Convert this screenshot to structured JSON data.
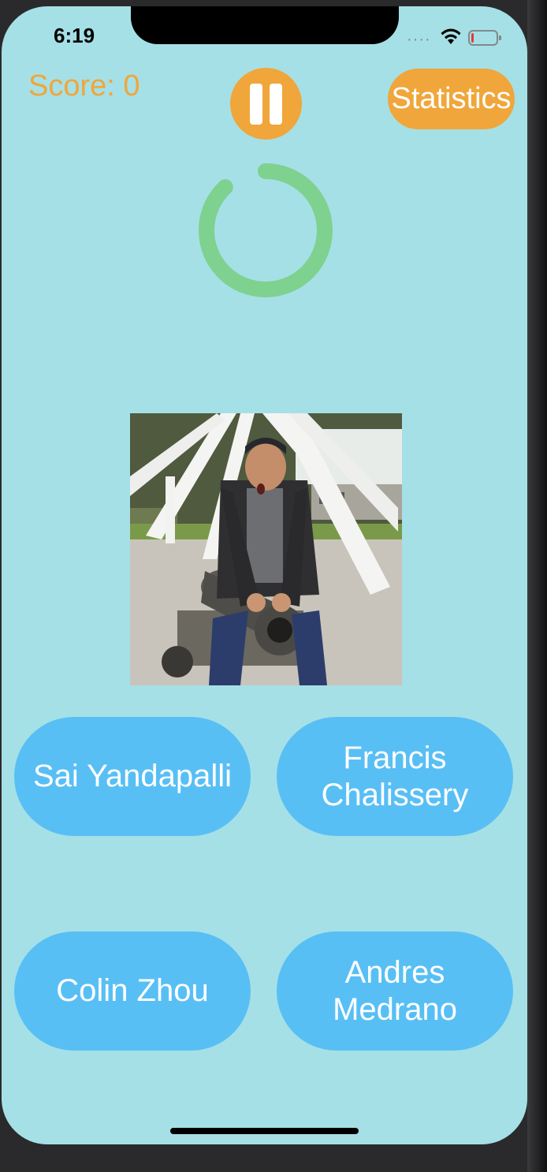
{
  "status_bar": {
    "time": "6:19",
    "signal_icon": "cellular-dots",
    "wifi_icon": "wifi",
    "battery_icon": "battery-low",
    "battery_level": 0.08
  },
  "header": {
    "score_text": "Score: 0",
    "pause_icon": "pause",
    "statistics_label": "Statistics"
  },
  "timer": {
    "progress": 0.88
  },
  "photo": {
    "subject": "person sitting on cannon"
  },
  "answers": [
    {
      "label": "Sai Yandapalli"
    },
    {
      "label": "Francis Chalissery"
    },
    {
      "label": "Colin Zhou"
    },
    {
      "label": "Andres Medrano"
    }
  ],
  "colors": {
    "background": "#a5e0e6",
    "accent_orange": "#f0a63a",
    "answer_blue": "#58bff5",
    "timer_green": "#7fd18f"
  }
}
